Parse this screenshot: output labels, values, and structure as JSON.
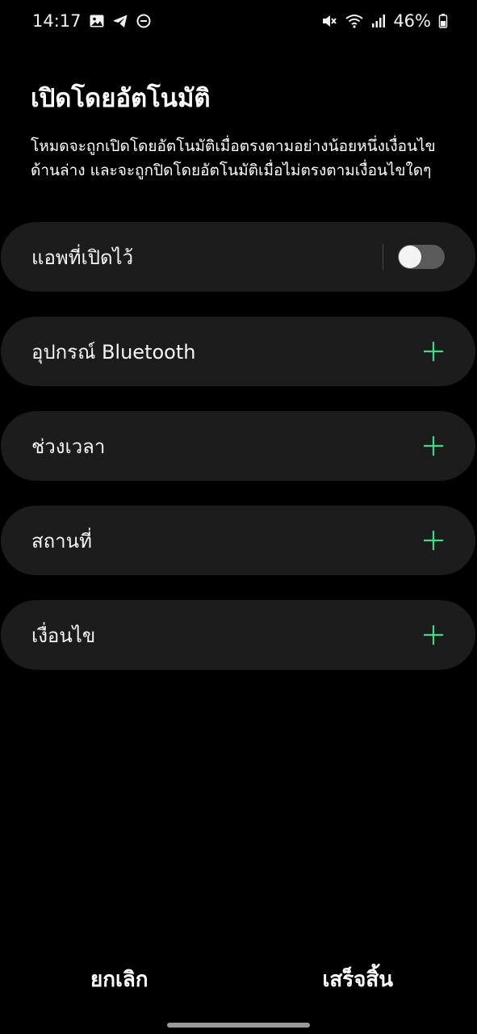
{
  "status_bar": {
    "time": "14:17",
    "left_icons": [
      "gallery-icon",
      "telegram-icon",
      "dnd-icon"
    ],
    "right_icons": [
      "mute-icon",
      "wifi-icon",
      "signal-icon"
    ],
    "battery": "46%"
  },
  "page": {
    "title": "เปิดโดยอัตโนมัติ",
    "description": "โหมดจะถูกเปิดโดยอัตโนมัติเมื่อตรงตามอย่างน้อยหนึ่งเงื่อนไขด้านล่าง และจะถูกปิดโดยอัตโนมัติเมื่อไม่ตรงตามเงื่อนไขใดๆ"
  },
  "conditions": {
    "open_apps": {
      "label": "แอพที่เปิดไว้",
      "toggle_on": false
    },
    "bluetooth": {
      "label": "อุปกรณ์ Bluetooth"
    },
    "time_period": {
      "label": "ช่วงเวลา"
    },
    "location": {
      "label": "สถานที่"
    },
    "condition": {
      "label": "เงื่อนไข"
    }
  },
  "colors": {
    "background": "#000000",
    "card": "#1c1c1c",
    "accent_green": "#3ddc84"
  },
  "bottom": {
    "cancel_label": "ยกเลิก",
    "done_label": "เสร็จสิ้น"
  }
}
